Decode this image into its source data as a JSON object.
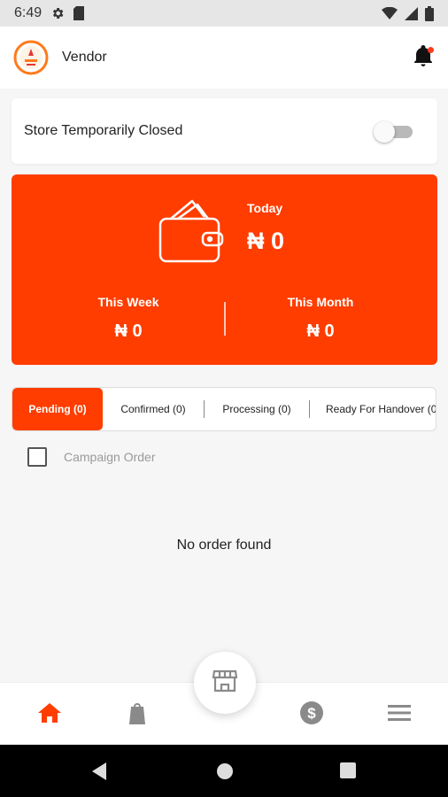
{
  "status_bar": {
    "time": "6:49",
    "icons": [
      "settings-icon",
      "sim-card-icon",
      "wifi-icon",
      "signal-icon",
      "battery-icon"
    ]
  },
  "header": {
    "title": "Vendor",
    "logo": "brand-logo",
    "notification_icon": "bell-icon",
    "has_notification_dot": true
  },
  "store_status": {
    "label": "Store Temporarily Closed",
    "toggle_on": false
  },
  "earnings": {
    "today_label": "Today",
    "today_value": "₦ 0",
    "week_label": "This Week",
    "week_value": "₦ 0",
    "month_label": "This Month",
    "month_value": "₦ 0",
    "icon": "wallet-icon"
  },
  "order_tabs": [
    {
      "label": "Pending (0)",
      "active": true
    },
    {
      "label": "Confirmed (0)",
      "active": false
    },
    {
      "label": "Processing (0)",
      "active": false
    },
    {
      "label": "Ready For Handover (0",
      "active": false
    }
  ],
  "campaign_filter": {
    "label": "Campaign Order",
    "checked": false
  },
  "empty_state": "No order found",
  "bottom_nav": {
    "items": [
      "home-icon",
      "shopping-bag-icon",
      "store-icon",
      "dollar-icon",
      "menu-icon"
    ],
    "active": "home-icon"
  },
  "colors": {
    "accent": "#ff3d00",
    "background": "#f6f6f6"
  }
}
